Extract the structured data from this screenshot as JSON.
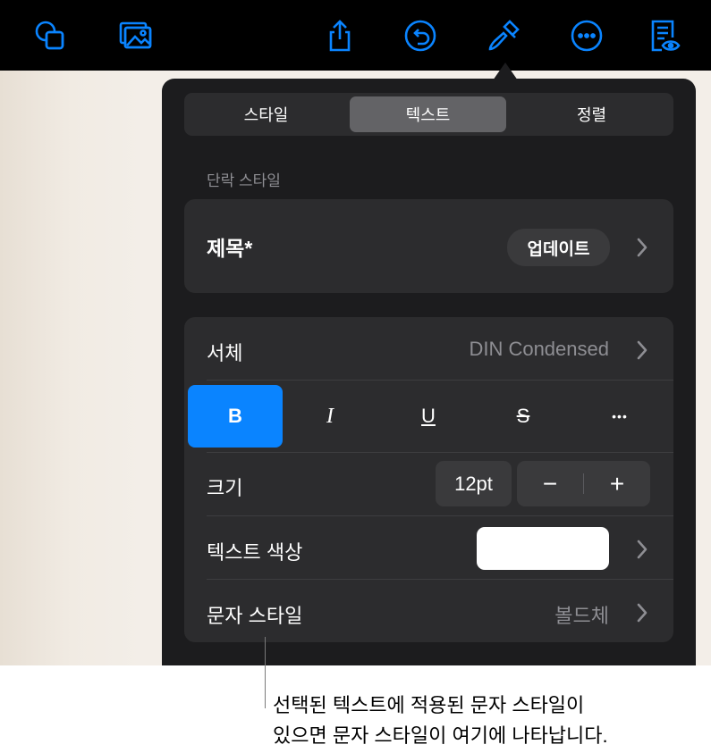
{
  "toolbar": {
    "icons": [
      "shapes-icon",
      "media-icon",
      "share-icon",
      "undo-icon",
      "format-brush-icon",
      "more-icon",
      "reader-view-icon"
    ],
    "icon_color": "#0a84ff"
  },
  "tabs": {
    "style": "스타일",
    "text": "텍스트",
    "arrange": "정렬",
    "selected": "텍스트"
  },
  "paragraph_style": {
    "header": "단락 스타일",
    "name": "제목*",
    "update_button": "업데이트"
  },
  "font": {
    "label": "서체",
    "value": "DIN Condensed"
  },
  "format_buttons": {
    "bold": "B",
    "italic": "I",
    "underline": "U",
    "strikethrough": "S",
    "more": "•••",
    "bold_active": true
  },
  "size": {
    "label": "크기",
    "value": "12pt",
    "decrease": "−",
    "increase": "+"
  },
  "text_color": {
    "label": "텍스트 색상",
    "value": "#ffffff"
  },
  "character_style": {
    "label": "문자 스타일",
    "value": "볼드체"
  },
  "callout": {
    "line1": "선택된 텍스트에 적용된 문자 스타일이",
    "line2": "있으면 문자 스타일이 여기에 나타납니다."
  },
  "colors": {
    "accent": "#0a84ff",
    "panel": "#1c1c1e",
    "card": "#2c2c2e"
  }
}
